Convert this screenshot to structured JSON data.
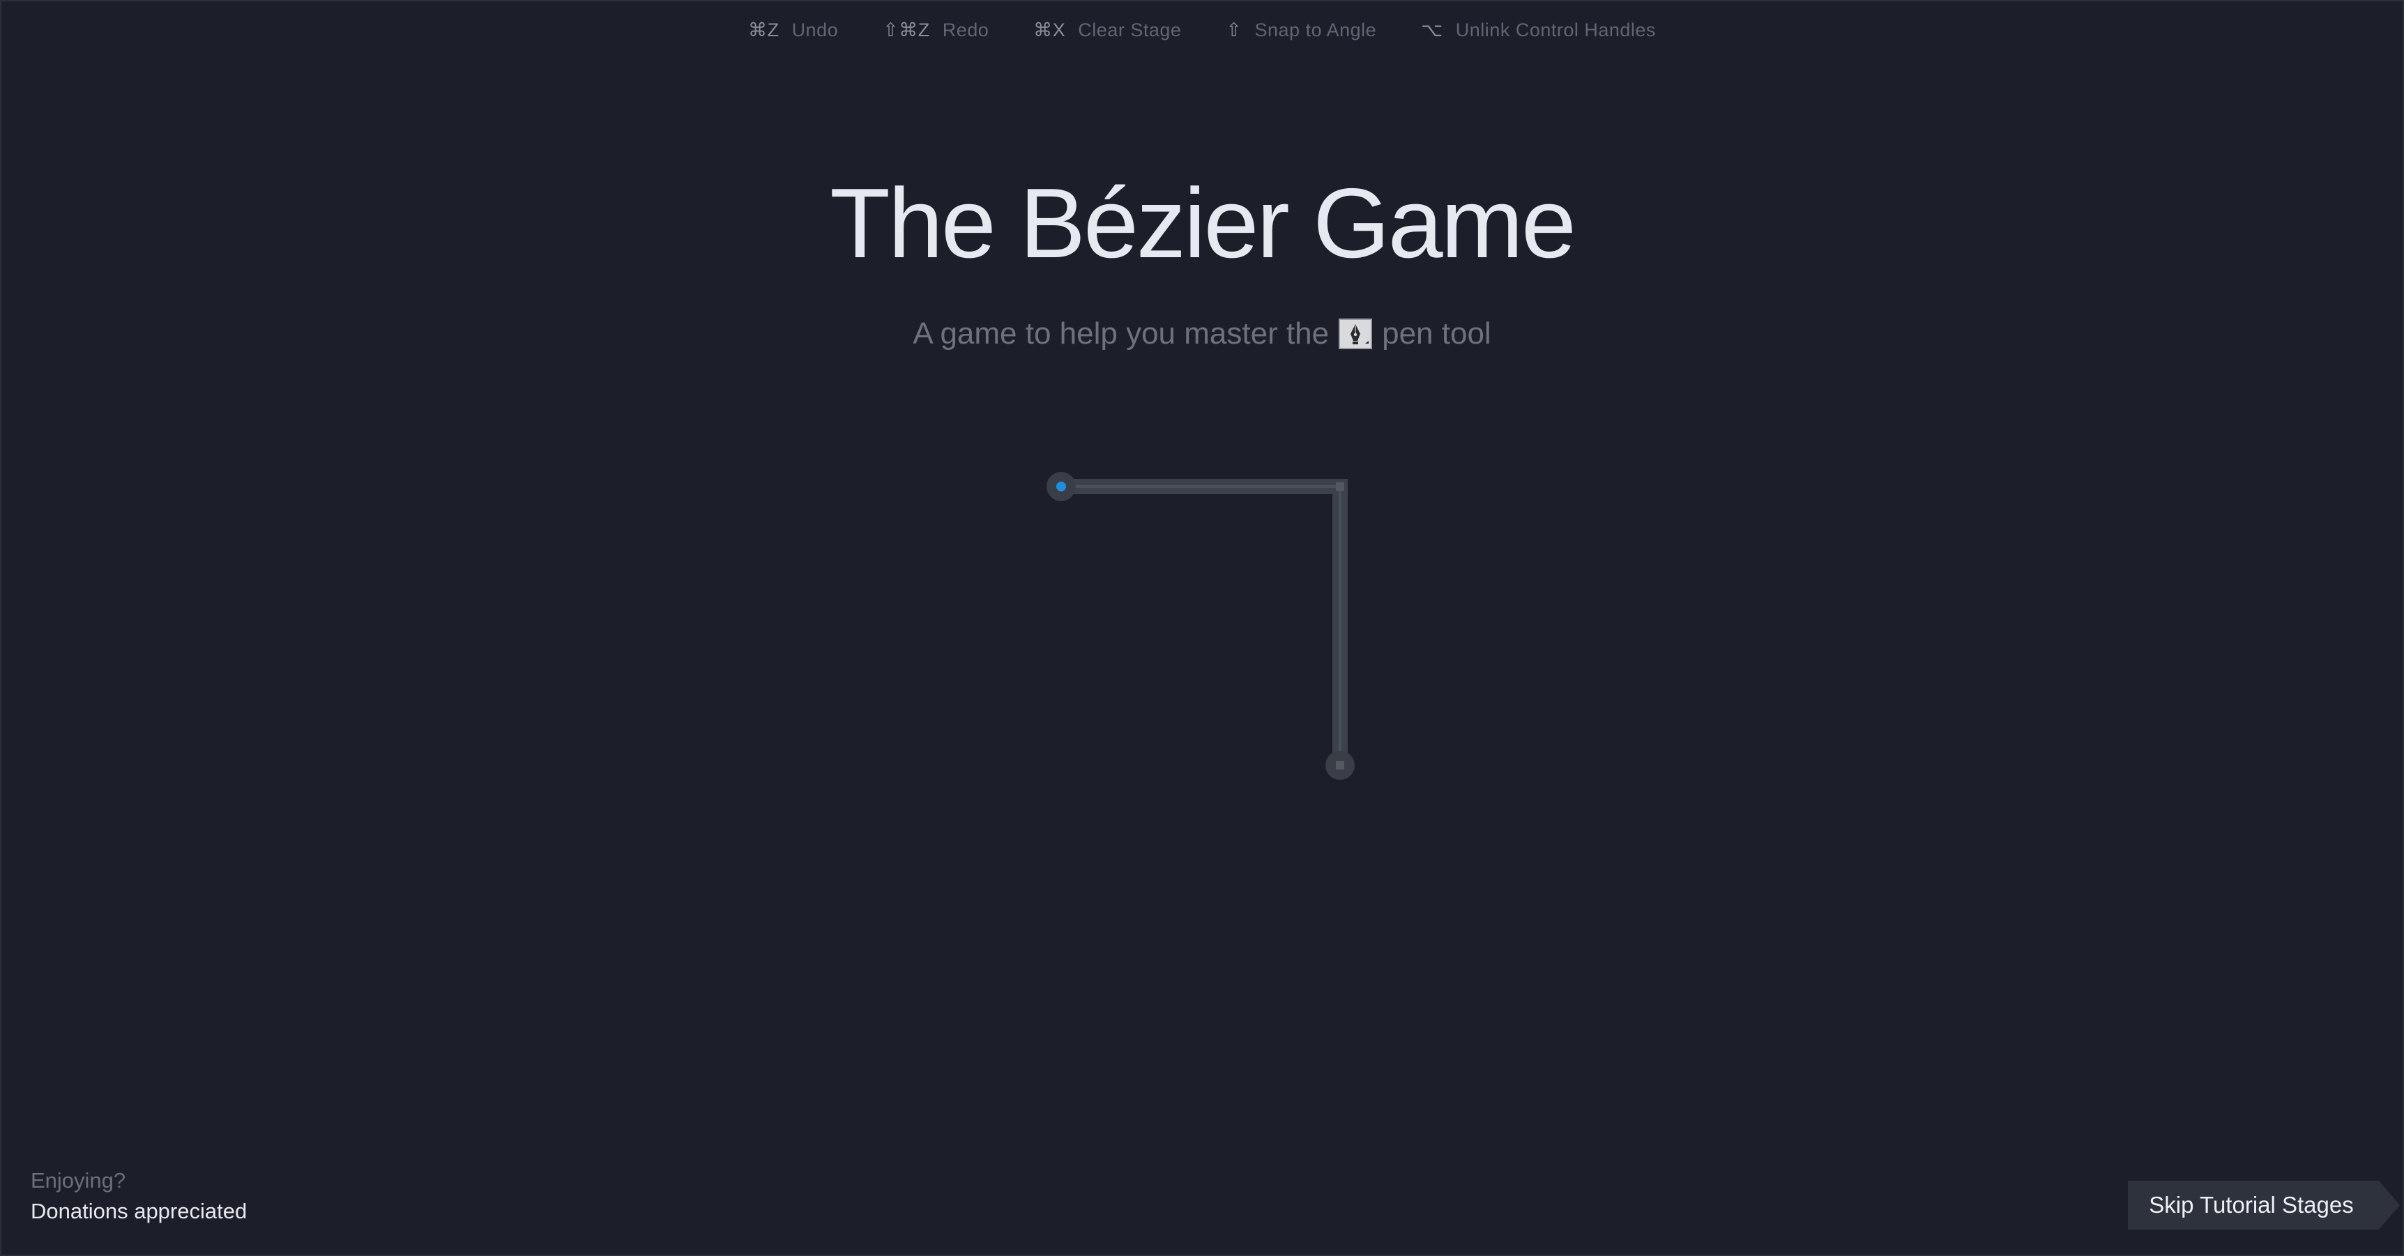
{
  "shortcuts": [
    {
      "key": "⌘Z",
      "label": "Undo"
    },
    {
      "key": "⇧⌘Z",
      "label": "Redo"
    },
    {
      "key": "⌘X",
      "label": "Clear Stage"
    },
    {
      "key": "⇧",
      "label": "Snap to Angle"
    },
    {
      "key": "⌥",
      "label": "Unlink Control Handles"
    }
  ],
  "title": "The Bézier Game",
  "subtitle": {
    "before": "A game to help you master the",
    "icon": "pen-tool-icon",
    "after": "pen tool"
  },
  "footer": {
    "enjoy_text": "Enjoying?",
    "donate_link": "Donations appreciated"
  },
  "skip_button": "Skip Tutorial Stages",
  "colors": {
    "background": "#1c1f29",
    "start_point": "#1e8fe0",
    "path_guide": "#4a4e57"
  }
}
